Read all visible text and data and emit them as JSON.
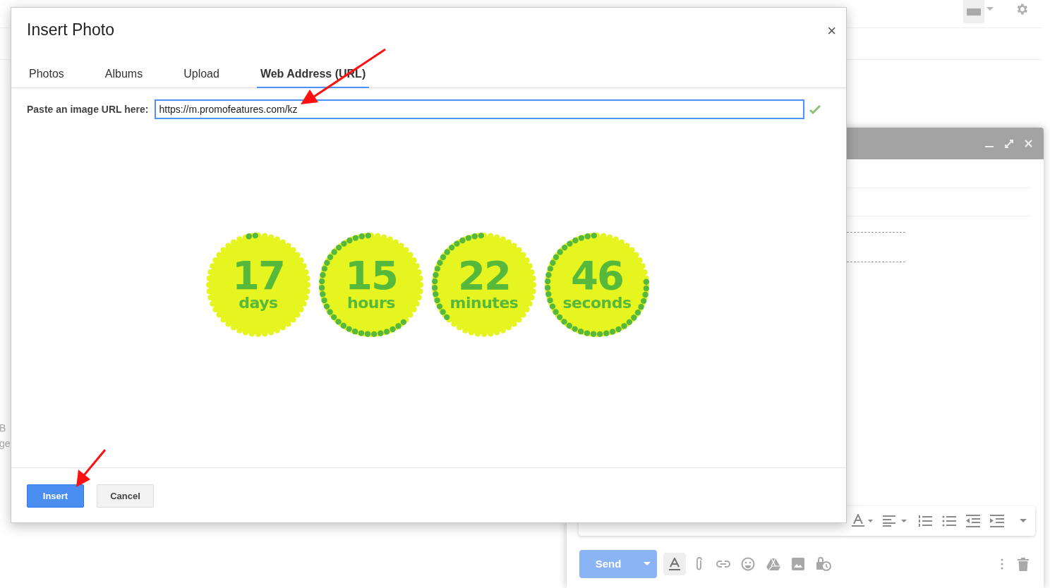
{
  "background": {
    "side_fragments": [
      "B",
      "ge"
    ],
    "compose": {
      "send_label": "Send"
    }
  },
  "dialog": {
    "title": "Insert Photo",
    "close": "×",
    "tabs": [
      {
        "label": "Photos",
        "selected": false
      },
      {
        "label": "Albums",
        "selected": false
      },
      {
        "label": "Upload",
        "selected": false
      },
      {
        "label": "Web Address (URL)",
        "selected": true
      }
    ],
    "url_label": "Paste an image URL here:",
    "url_value": "https://m.promofeatures.com/kz",
    "url_valid": true,
    "countdown": [
      {
        "value": "17",
        "unit": "days",
        "kind": "days"
      },
      {
        "value": "15",
        "unit": "hours",
        "kind": "hours"
      },
      {
        "value": "22",
        "unit": "minutes",
        "kind": "minutes"
      },
      {
        "value": "46",
        "unit": "seconds",
        "kind": "seconds"
      }
    ],
    "buttons": [
      {
        "label": "Insert",
        "kind": "primary"
      },
      {
        "label": "Cancel",
        "kind": "secondary"
      }
    ]
  }
}
